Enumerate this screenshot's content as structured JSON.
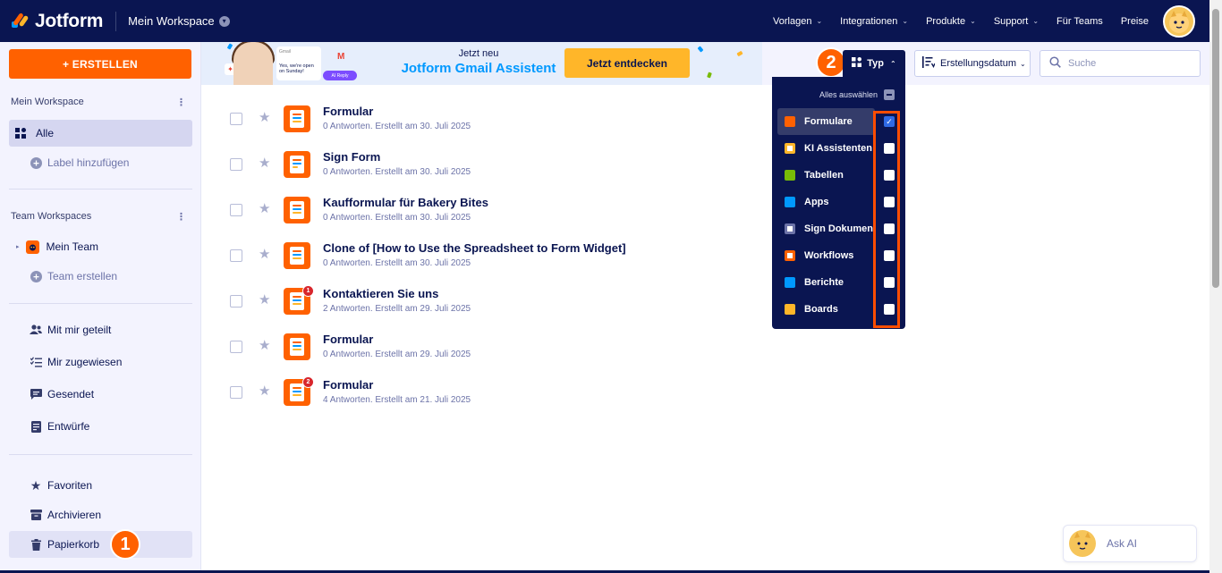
{
  "topnav": {
    "brand": "Jotform",
    "workspace": "Mein Workspace",
    "links": [
      {
        "label": "Vorlagen",
        "chevron": "⌄"
      },
      {
        "label": "Integrationen",
        "chevron": "⌄"
      },
      {
        "label": "Produkte",
        "chevron": "⌄"
      },
      {
        "label": "Support",
        "chevron": "⌄"
      },
      {
        "label": "Für Teams",
        "chevron": ""
      },
      {
        "label": "Preise",
        "chevron": ""
      }
    ]
  },
  "sidebar": {
    "create_label": "+ ERSTELLEN",
    "my_workspace_heading": "Mein Workspace",
    "all_label": "Alle",
    "add_label": "Label hinzufügen",
    "team_heading": "Team Workspaces",
    "my_team": "Mein Team",
    "create_team": "Team erstellen",
    "shared": "Mit mir geteilt",
    "assigned": "Mir zugewiesen",
    "sent": "Gesendet",
    "drafts": "Entwürfe",
    "favorites": "Favoriten",
    "archive": "Archivieren",
    "trash": "Papierkorb",
    "kebab": "⋮"
  },
  "annotations": {
    "one": "1",
    "two": "2"
  },
  "banner": {
    "small": "Jetzt neu",
    "big": "Jotform Gmail Assistent",
    "cta": "Jetzt entdecken",
    "card_text": "Yes, we're open on Sunday!",
    "chip": "AI Reply",
    "card_label": "Gmail"
  },
  "toolbar": {
    "type_label": "Typ",
    "sort_label": "Erstellungsdatum",
    "search_placeholder": "Suche"
  },
  "dropdown": {
    "select_all": "Alles auswählen",
    "items": [
      {
        "label": "Formulare",
        "checked": true,
        "color": "#ff6100"
      },
      {
        "label": "KI Assistenten",
        "checked": false,
        "color": "#ffb629"
      },
      {
        "label": "Tabellen",
        "checked": false,
        "color": "#78bb07"
      },
      {
        "label": "Apps",
        "checked": false,
        "color": "#0099ff"
      },
      {
        "label": "Sign Dokumente",
        "checked": false,
        "color": "#6c73a8"
      },
      {
        "label": "Workflows",
        "checked": false,
        "color": "#ff6100"
      },
      {
        "label": "Berichte",
        "checked": false,
        "color": "#0099ff"
      },
      {
        "label": "Boards",
        "checked": false,
        "color": "#ffb629"
      }
    ]
  },
  "forms": [
    {
      "title": "Formular",
      "meta": "0 Antworten. Erstellt am 30. Juli 2025",
      "badge": ""
    },
    {
      "title": "Sign Form",
      "meta": "0 Antworten. Erstellt am 30. Juli 2025",
      "badge": ""
    },
    {
      "title": "Kaufformular für Bakery Bites",
      "meta": "0 Antworten. Erstellt am 30. Juli 2025",
      "badge": ""
    },
    {
      "title": "Clone of [How to Use the Spreadsheet to Form Widget]",
      "meta": "0 Antworten. Erstellt am 30. Juli 2025",
      "badge": ""
    },
    {
      "title": "Kontaktieren Sie uns",
      "meta": "2 Antworten. Erstellt am 29. Juli 2025",
      "badge": "1"
    },
    {
      "title": "Formular",
      "meta": "0 Antworten. Erstellt am 29. Juli 2025",
      "badge": ""
    },
    {
      "title": "Formular",
      "meta": "4 Antworten. Erstellt am 21. Juli 2025",
      "badge": "2"
    }
  ],
  "askai": {
    "label": "Ask AI"
  },
  "colors": {
    "navy": "#0a1551",
    "orange": "#ff6100",
    "accent_blue": "#0099ff",
    "highlight": "#ff4d00"
  }
}
